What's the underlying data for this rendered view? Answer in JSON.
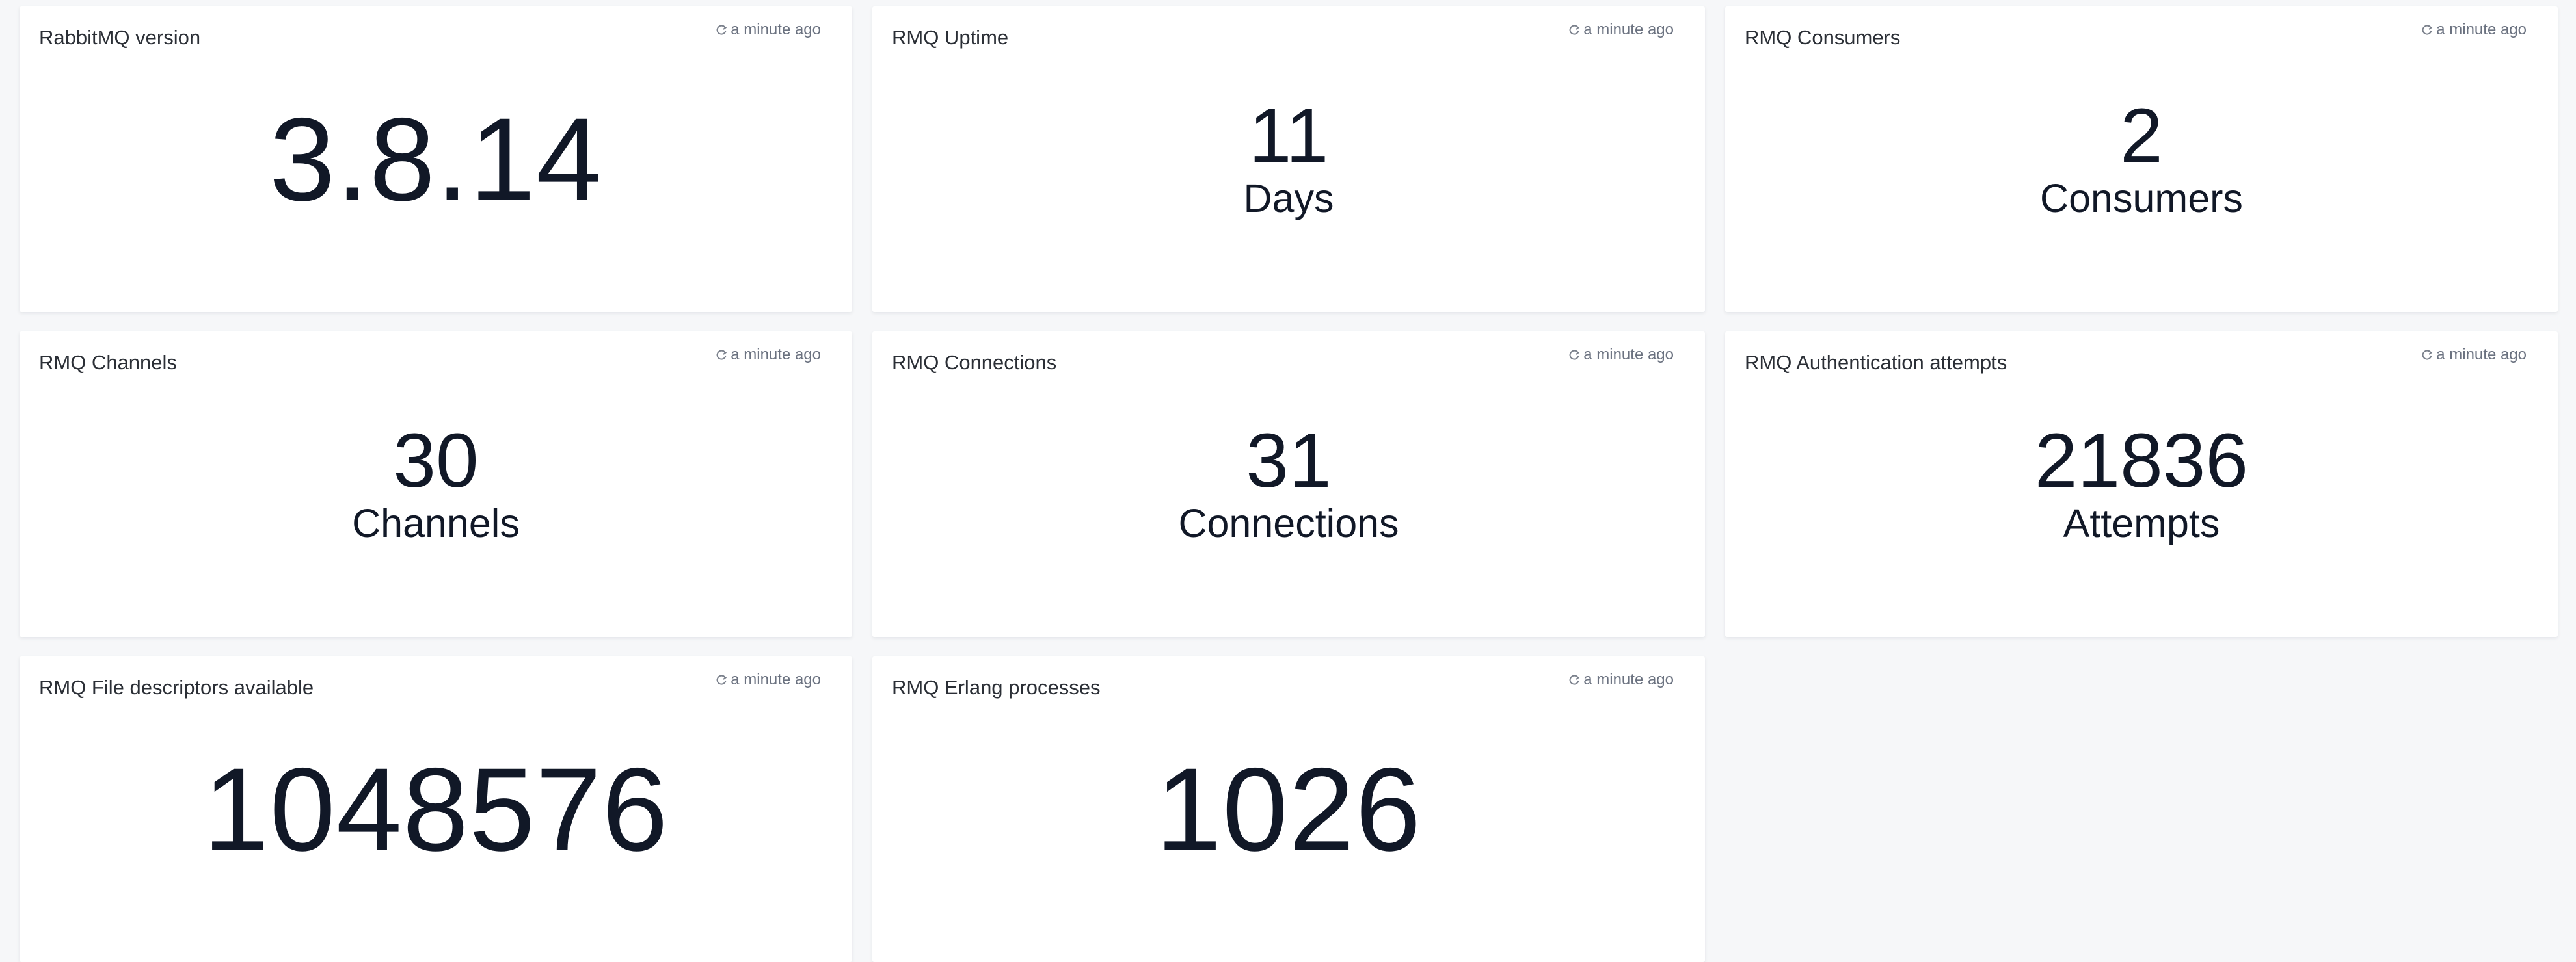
{
  "widgets": [
    {
      "title": "RabbitMQ version",
      "refresh": "a minute ago",
      "value": "3.8.14",
      "unit": ""
    },
    {
      "title": "RMQ Uptime",
      "refresh": "a minute ago",
      "value": "11",
      "unit": "Days"
    },
    {
      "title": "RMQ Consumers",
      "refresh": "a minute ago",
      "value": "2",
      "unit": "Consumers"
    },
    {
      "title": "RMQ Channels",
      "refresh": "a minute ago",
      "value": "30",
      "unit": "Channels"
    },
    {
      "title": "RMQ Connections",
      "refresh": "a minute ago",
      "value": "31",
      "unit": "Connections"
    },
    {
      "title": "RMQ Authentication attempts",
      "refresh": "a minute ago",
      "value": "21836",
      "unit": "Attempts"
    },
    {
      "title": "RMQ File descriptors available",
      "refresh": "a minute ago",
      "value": "1048576",
      "unit": ""
    },
    {
      "title": "RMQ Erlang processes",
      "refresh": "a minute ago",
      "value": "1026",
      "unit": ""
    }
  ],
  "icons": {
    "refresh": "refresh-icon"
  },
  "colors": {
    "background": "#f6f7f9",
    "card": "#ffffff",
    "value_text": "#111827",
    "muted_text": "#6b7280"
  }
}
